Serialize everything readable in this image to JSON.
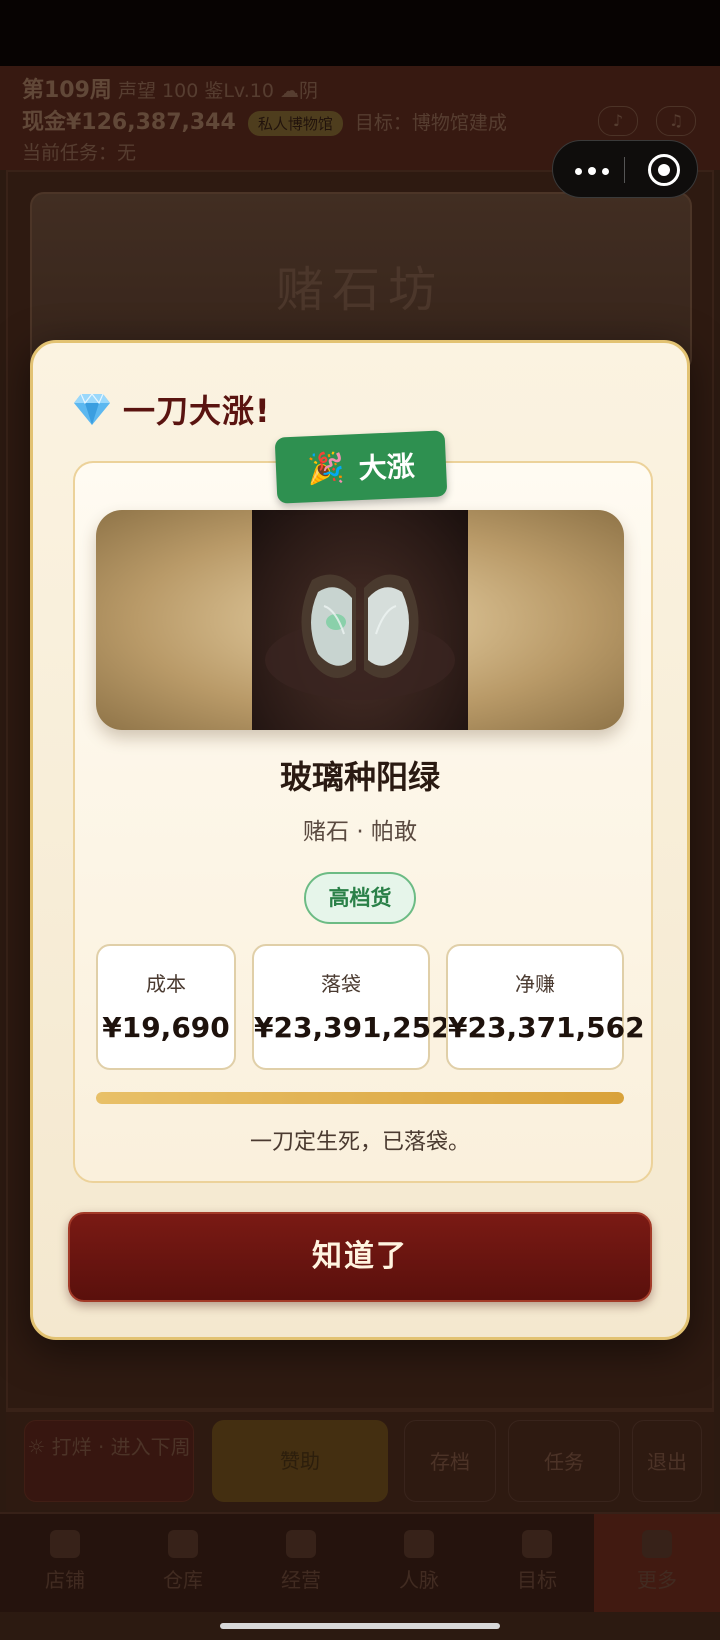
{
  "background": {
    "week": "第109周",
    "reputation": "声望 100",
    "appraisal_level": "鉴Lv.10",
    "weather": "☁阴",
    "cash": "现金¥126,387,344",
    "museum_chip": "私人博物馆",
    "goal": "目标：博物馆建成",
    "current_task": "当前任务：无",
    "scene_title": "赌石坊",
    "action_end_week": "打烊 · 进入下周",
    "action_sponsor": "赞助",
    "action_save": "存档",
    "action_tasks": "任务",
    "action_exit": "退出",
    "tabs": [
      "店铺",
      "仓库",
      "经营",
      "人脉",
      "目标",
      "更多"
    ]
  },
  "modal": {
    "title": "一刀大涨!",
    "title_icon": "gem-icon",
    "ribbon_icon": "party-popper-icon",
    "ribbon_label": "大涨",
    "item_name": "玻璃种阳绿",
    "item_subtitle": "赌石 · 帕敢",
    "grade": "高档货",
    "stats": [
      {
        "label": "成本",
        "value": "¥19,690"
      },
      {
        "label": "落袋",
        "value": "¥23,391,252"
      },
      {
        "label": "净赚",
        "value": "¥23,371,562"
      }
    ],
    "progress": 1.0,
    "footnote": "一刀定生死，已落袋。",
    "confirm_label": "知道了"
  },
  "colors": {
    "accent_red": "#6a1410",
    "success_green": "#2e9050",
    "gold": "#d9a23a",
    "cream": "#fbf3e1"
  }
}
